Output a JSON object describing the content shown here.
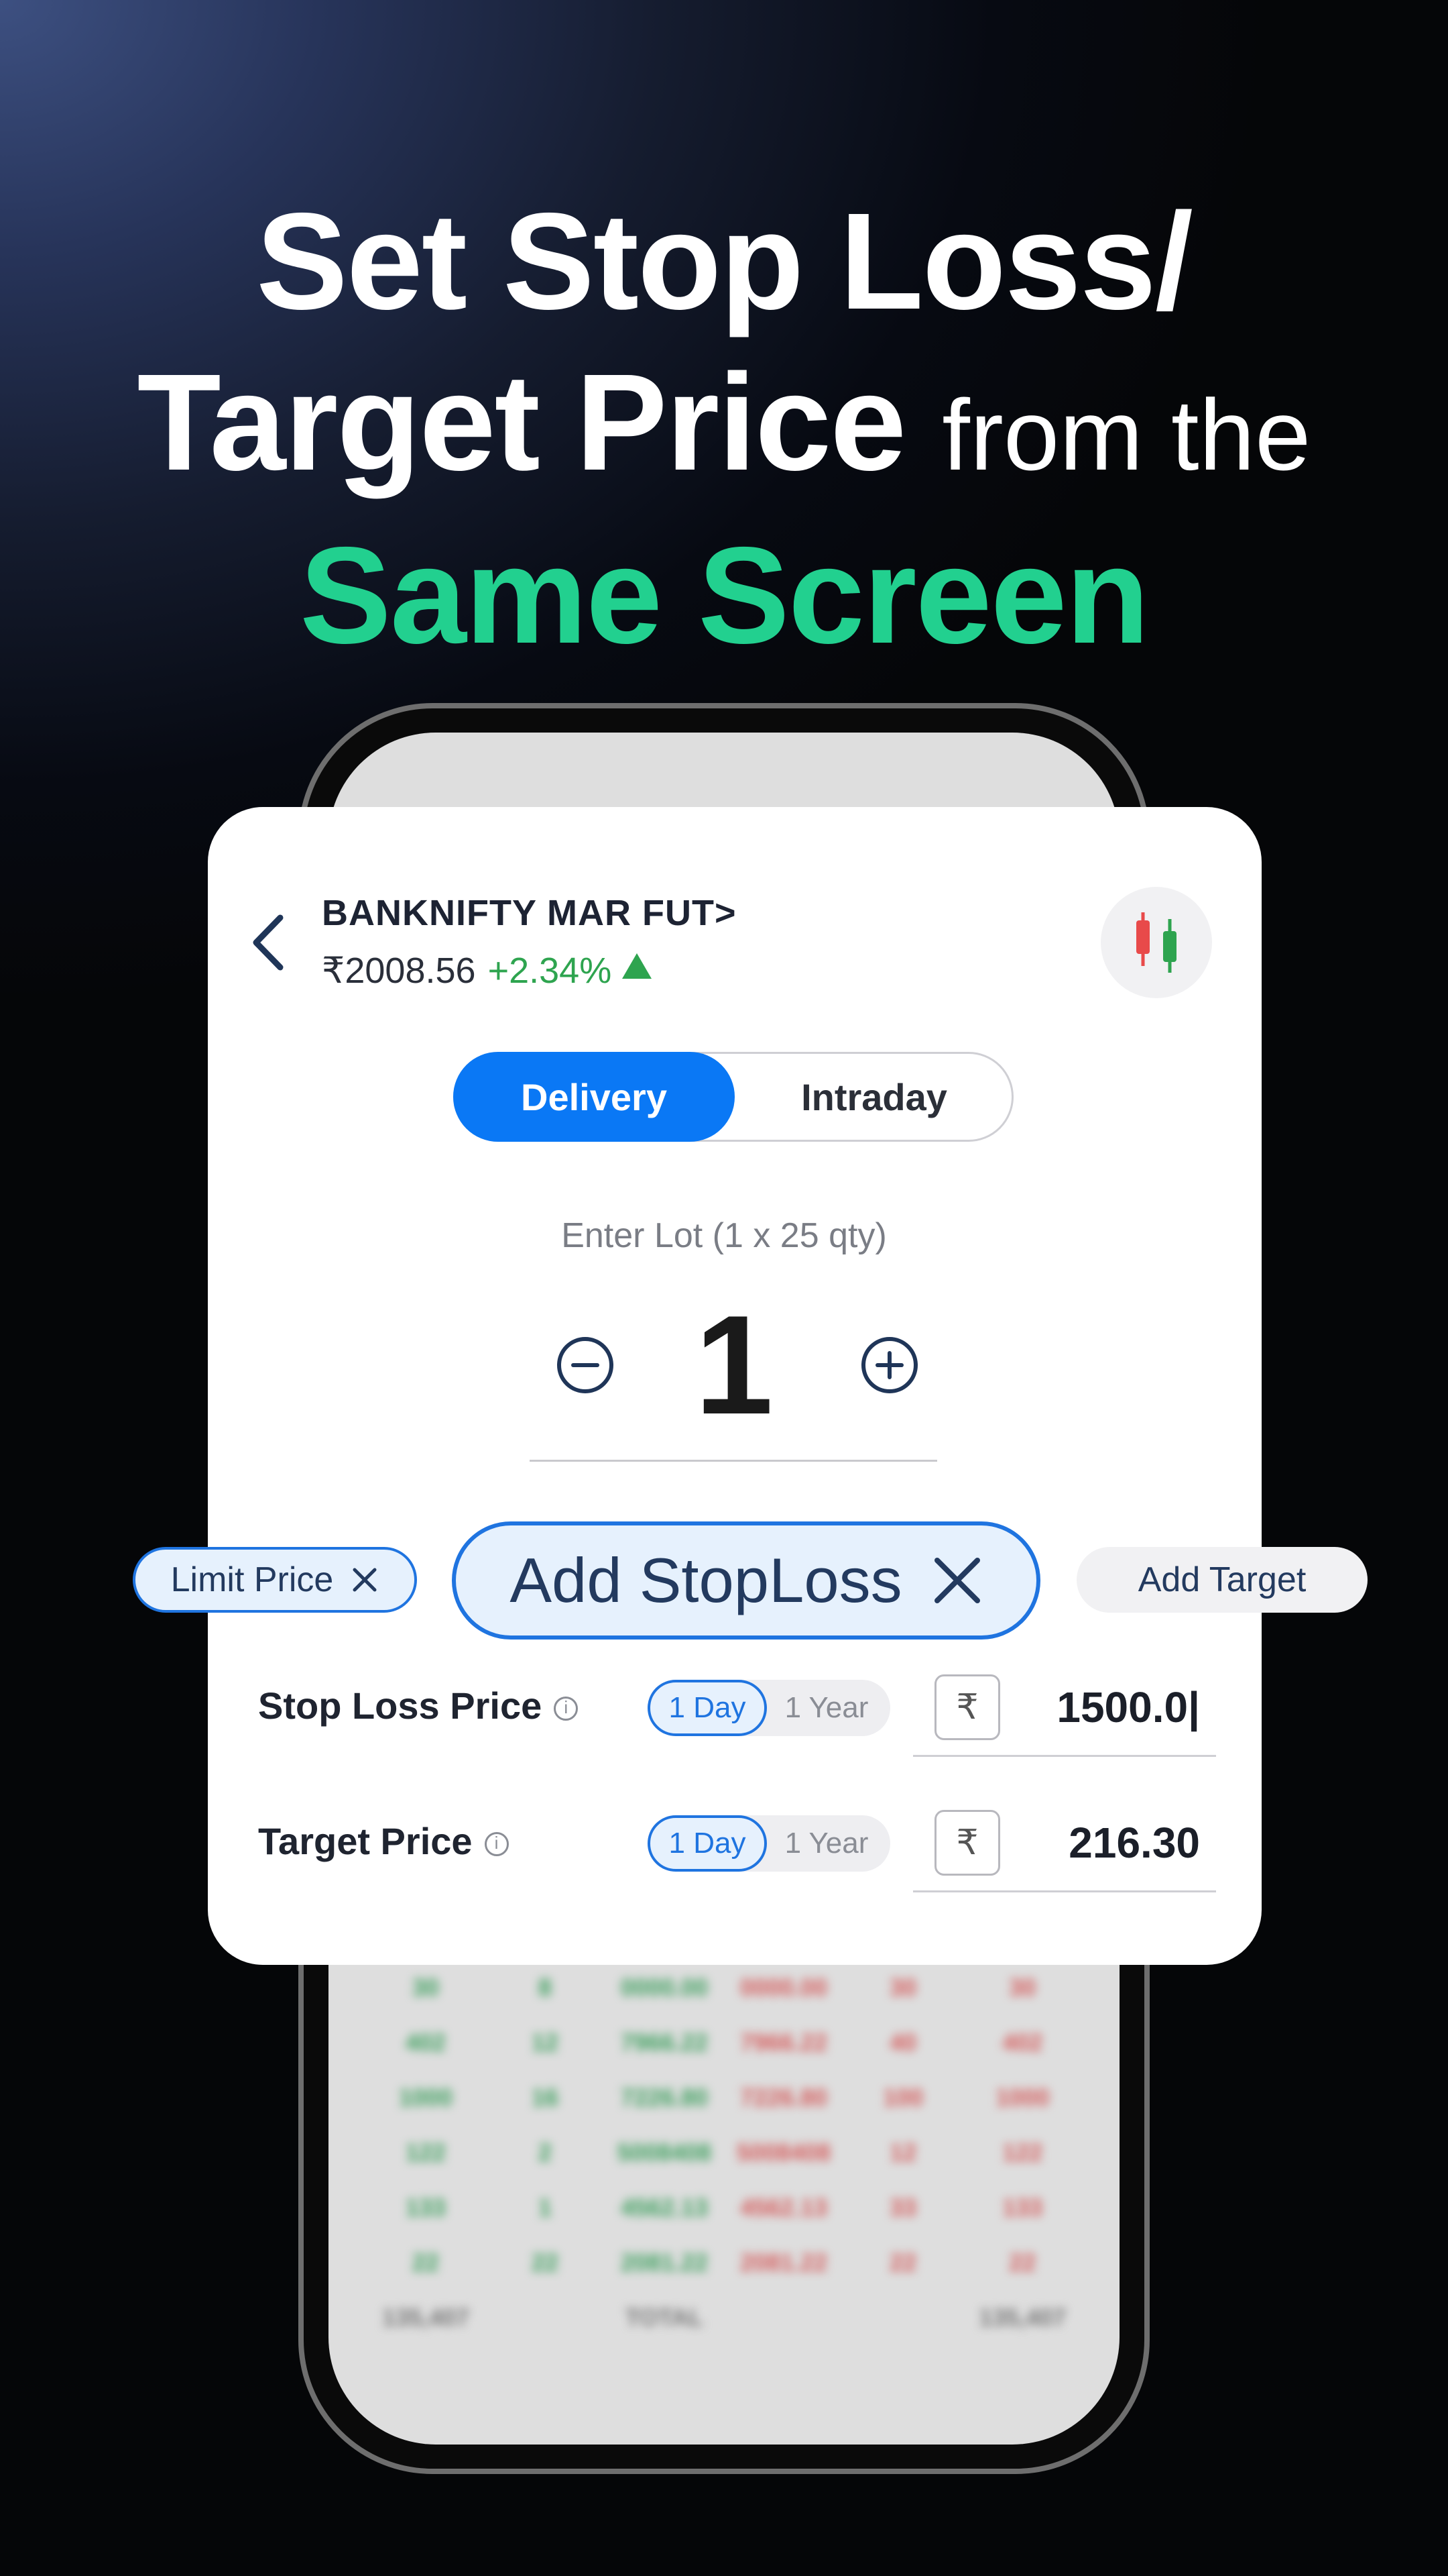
{
  "headline": {
    "line1": "Set Stop Loss/",
    "line2_bold": "Target Price",
    "line2_light": "from the",
    "line3": "Same Screen"
  },
  "instrument": {
    "name": "BANKNIFTY MAR FUT>",
    "price": "₹2008.56",
    "change": "+2.34%"
  },
  "segment": {
    "delivery": "Delivery",
    "intraday": "Intraday"
  },
  "lot": {
    "label": "Enter Lot (1 x 25 qty)",
    "value": "1"
  },
  "chips": {
    "limit": "Limit Price",
    "stoploss": "Add StopLoss",
    "target": "Add Target"
  },
  "stop_loss": {
    "label": "Stop Loss Price",
    "day": "1 Day",
    "year": "1 Year",
    "currency": "₹",
    "value": "1500.0|"
  },
  "target_price": {
    "label": "Target Price",
    "day": "1 Day",
    "year": "1 Year",
    "currency": "₹",
    "value": "216.30"
  },
  "colors": {
    "accent": "#0a78f5",
    "green": "#22d08f",
    "up": "#2ea44f"
  }
}
